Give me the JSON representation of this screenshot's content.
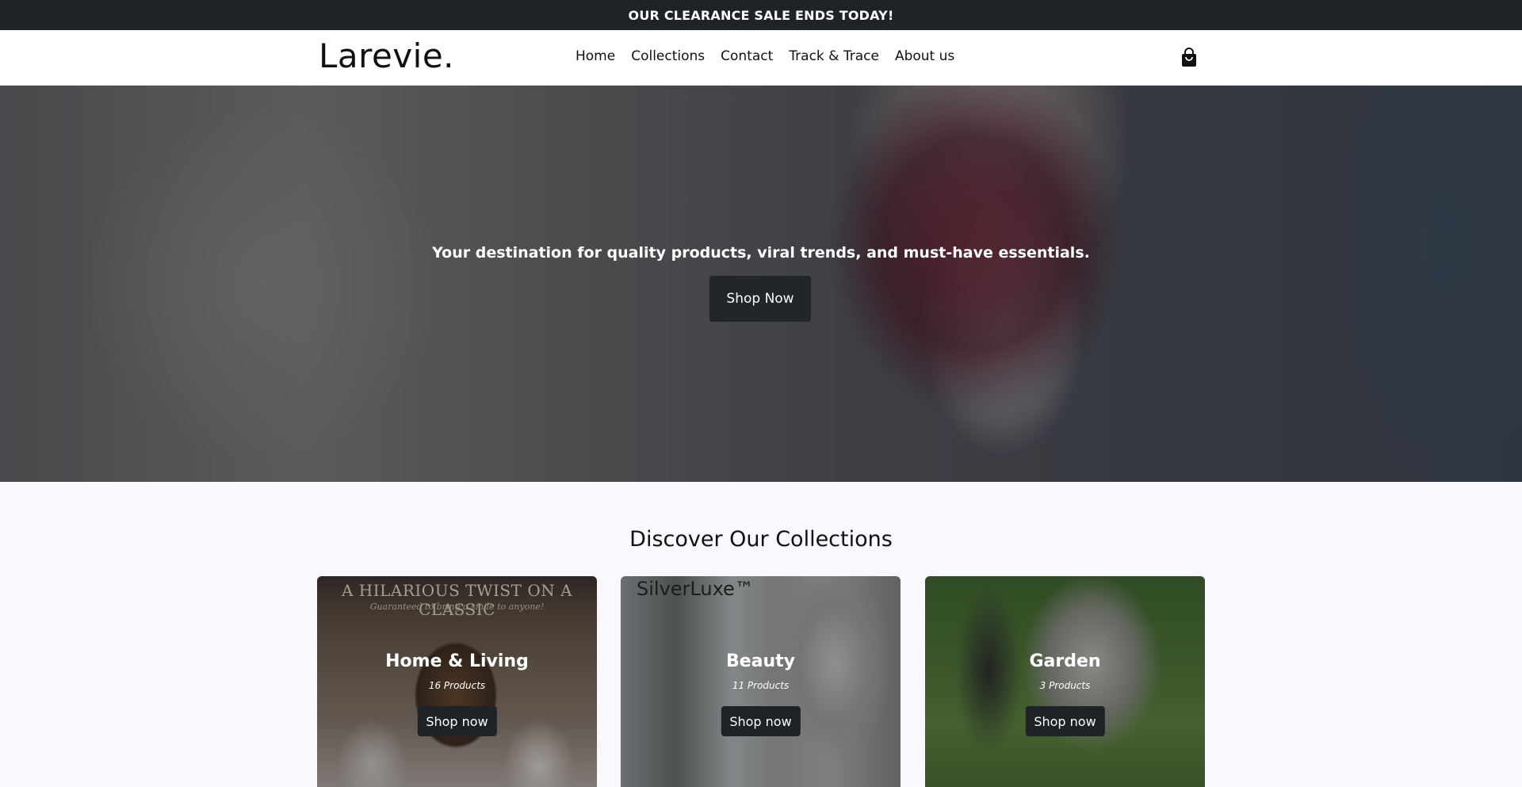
{
  "announcement": {
    "text": "OUR CLEARANCE SALE ENDS TODAY!"
  },
  "header": {
    "logo": "Larevie.",
    "nav": [
      {
        "label": "Home"
      },
      {
        "label": "Collections"
      },
      {
        "label": "Contact"
      },
      {
        "label": "Track & Trace"
      },
      {
        "label": "About us"
      }
    ],
    "cart_icon": "shopping-bag-icon"
  },
  "hero": {
    "tagline": "Your destination for quality products, viral trends, and must-have essentials.",
    "cta_label": "Shop Now"
  },
  "collections": {
    "title": "Discover Our Collections",
    "items": [
      {
        "name": "Home & Living",
        "count": "16 Products",
        "button": "Shop now",
        "image_banner": "A HILARIOUS TWIST ON A CLASSIC",
        "image_subtext": "Guaranteed to bring a smile to anyone!"
      },
      {
        "name": "Beauty",
        "count": "11 Products",
        "button": "Shop now",
        "image_brand": "SilverLuxe™"
      },
      {
        "name": "Garden",
        "count": "3 Products",
        "button": "Shop now"
      }
    ]
  }
}
